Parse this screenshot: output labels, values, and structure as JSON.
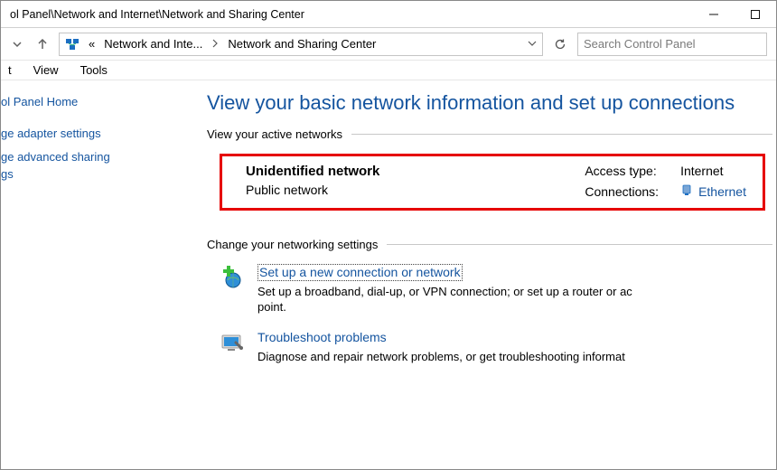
{
  "title_path": "ol Panel\\Network and Internet\\Network and Sharing Center",
  "breadcrumb": {
    "prefix_glyph": "«",
    "part1": "Network and Inte...",
    "part2": "Network and Sharing Center"
  },
  "search": {
    "placeholder": "Search Control Panel"
  },
  "menu": {
    "item0": "t",
    "item1": "View",
    "item2": "Tools"
  },
  "sidebar": {
    "home": "ol Panel Home",
    "link0": "ge adapter settings",
    "link1": "ge advanced sharing\ngs"
  },
  "main": {
    "heading": "View your basic network information and set up connections",
    "section_active": "View your active networks",
    "network": {
      "name": "Unidentified network",
      "type": "Public network",
      "access_label": "Access type:",
      "access_value": "Internet",
      "conn_label": "Connections:",
      "conn_value": "Ethernet"
    },
    "section_settings": "Change your networking settings",
    "setup": {
      "title": "Set up a new connection or network",
      "desc": "Set up a broadband, dial-up, or VPN connection; or set up a router or ac\npoint."
    },
    "trouble": {
      "title": "Troubleshoot problems",
      "desc": "Diagnose and repair network problems, or get troubleshooting informat"
    }
  }
}
